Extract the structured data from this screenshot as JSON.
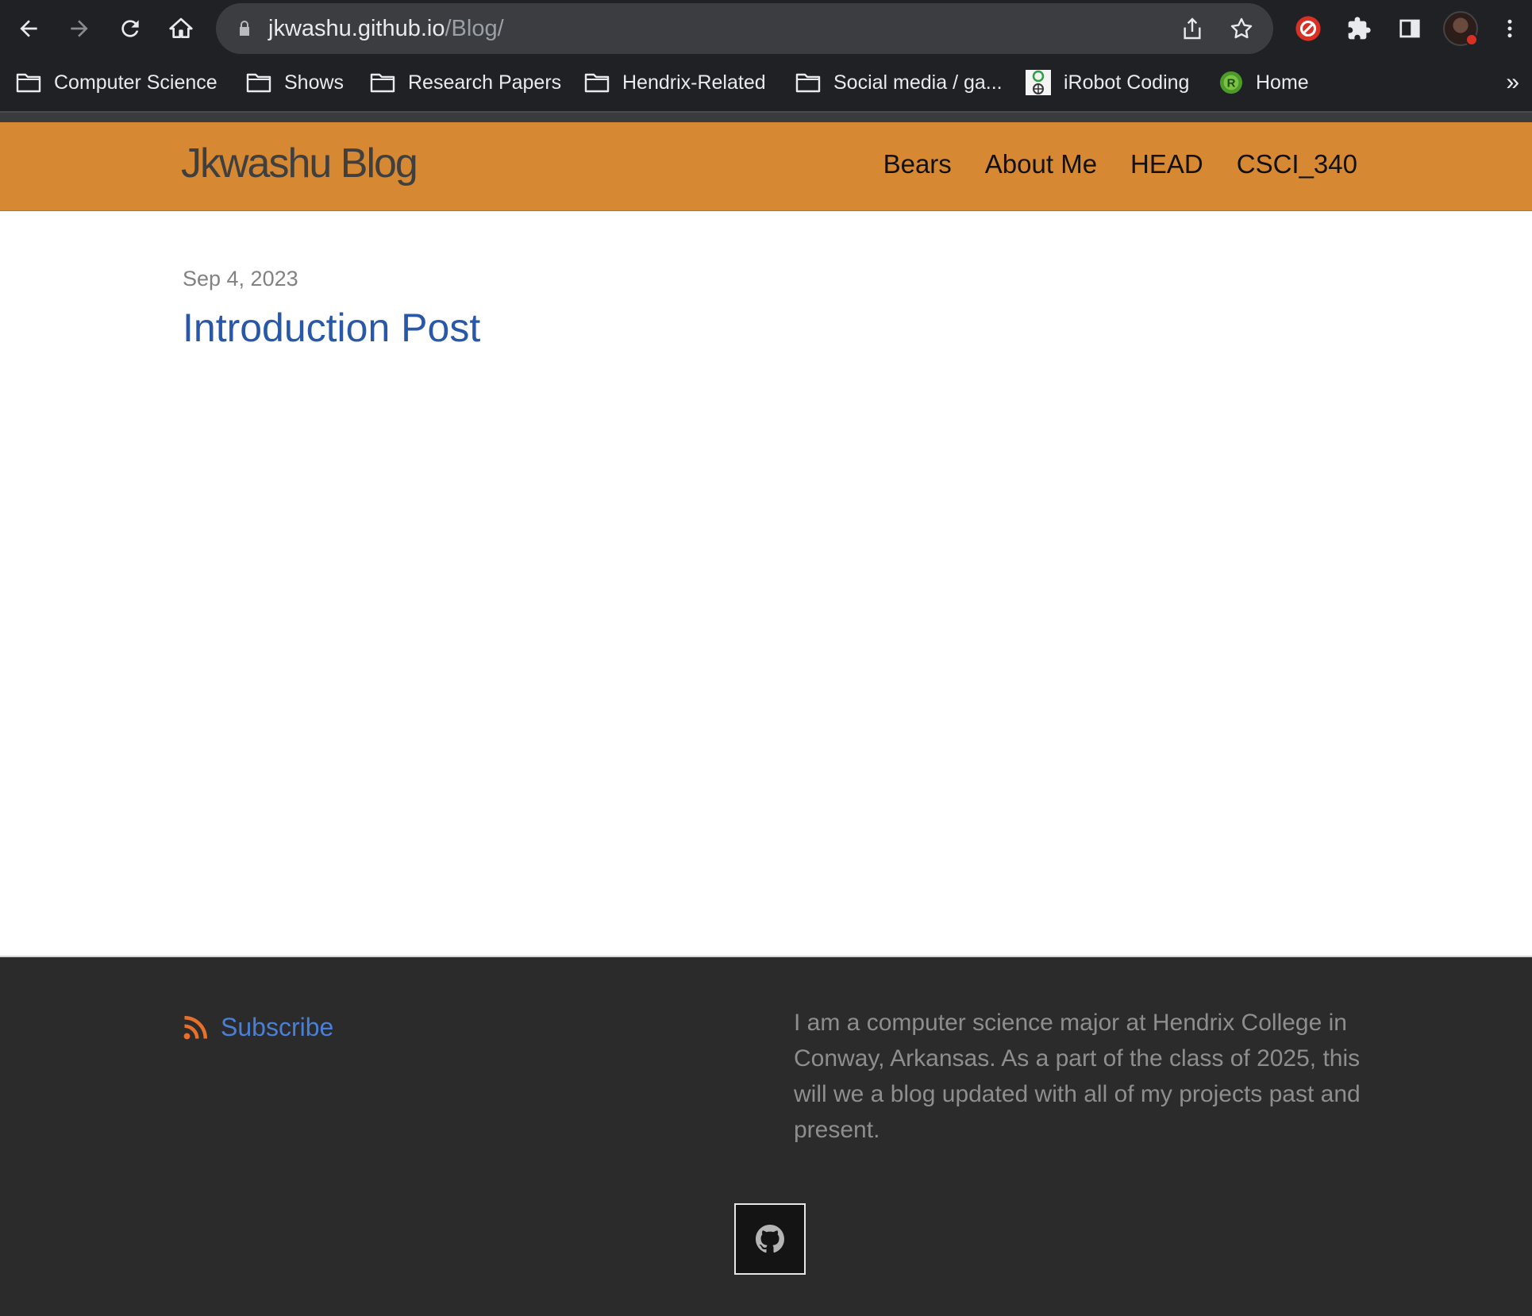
{
  "browser": {
    "url_host": "jkwashu.github.io",
    "url_path": "/Blog/",
    "nav_icons": [
      "back-icon",
      "forward-icon",
      "reload-icon",
      "home-icon"
    ],
    "omnibox_icons": [
      "lock-icon",
      "share-icon",
      "star-icon"
    ],
    "extension_icons": [
      "red-extension-icon",
      "puzzle-icon",
      "side-panel-icon",
      "more-vert-icon"
    ],
    "bookmarks": [
      {
        "label": "Computer Science",
        "icon": "folder-icon"
      },
      {
        "label": "Shows",
        "icon": "folder-icon"
      },
      {
        "label": "Research Papers",
        "icon": "folder-icon"
      },
      {
        "label": "Hendrix-Related",
        "icon": "folder-icon"
      },
      {
        "label": "Social media / ga...",
        "icon": "folder-icon"
      },
      {
        "label": "iRobot Coding",
        "icon": "irobot-icon"
      },
      {
        "label": "Home",
        "icon": "green-r-icon"
      }
    ],
    "bookmarks_more": "»"
  },
  "site": {
    "title": "Jkwashu Blog",
    "nav": [
      "Bears",
      "About Me",
      "HEAD",
      "CSCI_340"
    ],
    "header_color": "#d68832"
  },
  "post": {
    "date": "Sep 4, 2023",
    "title": "Introduction Post"
  },
  "footer": {
    "subscribe_label": "Subscribe",
    "about_text": "I am a computer science major at Hendrix College in Conway, Arkansas. As a part of the class of 2025, this will we a blog updated with all of my projects past and present.",
    "social_icon": "github-icon"
  }
}
